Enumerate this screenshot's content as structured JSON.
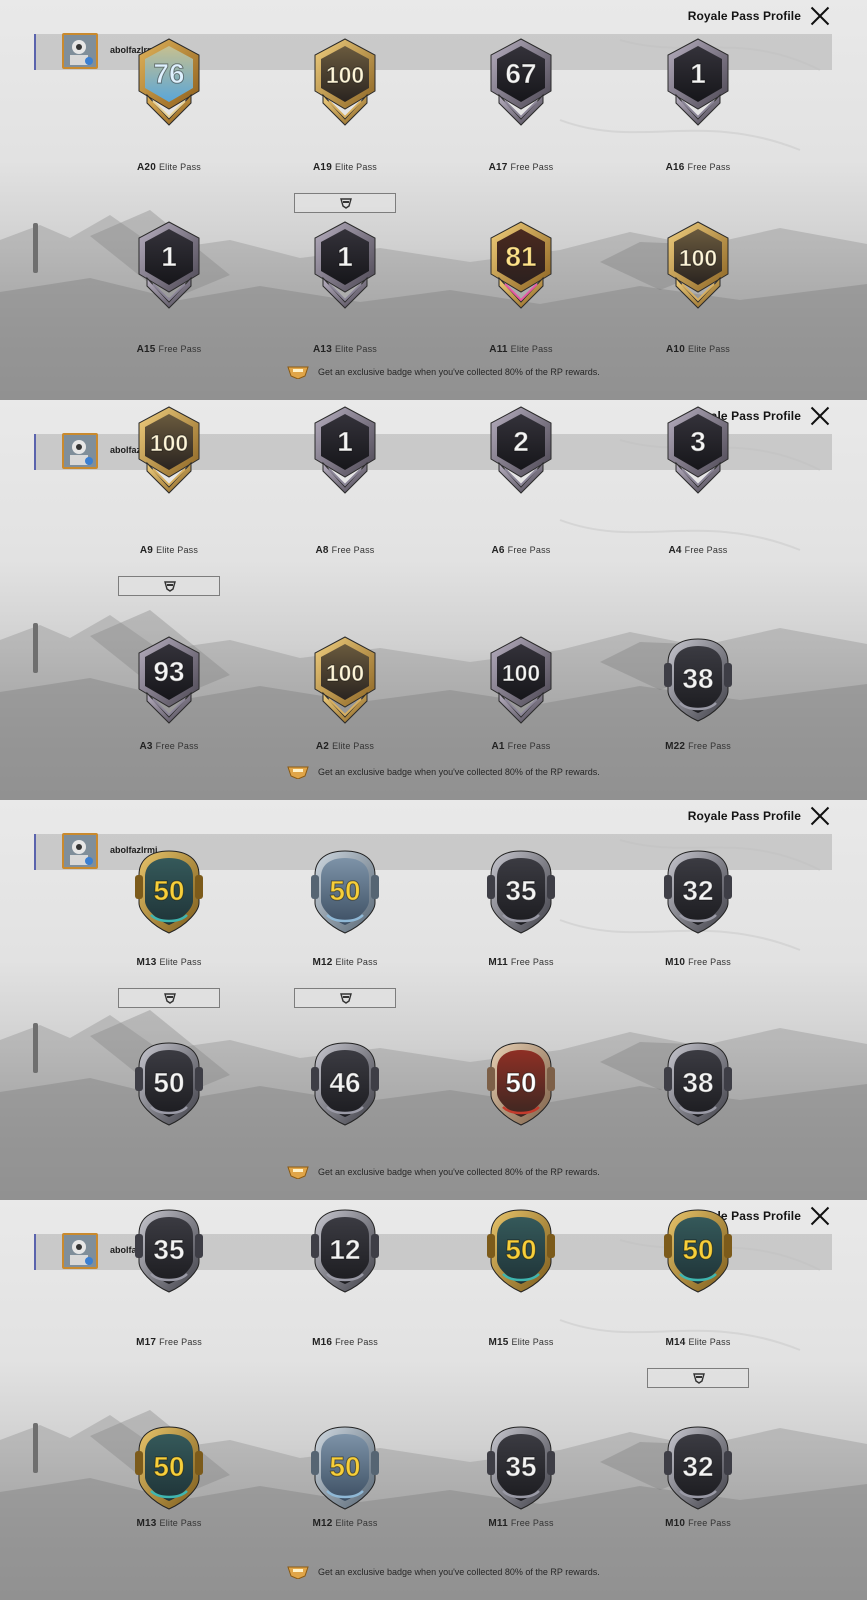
{
  "colors": {
    "accent_bar": "#5a63ad",
    "avatar_border": "#c98a2e",
    "free_pass_badge": "#1c1c20",
    "elite_gold": "#c99a44",
    "elite_teal": "#3fb6b0"
  },
  "screens": [
    {
      "header_title": "Royale Pass Profile",
      "username": "abolfazlrmj",
      "footer_text": "Get an exclusive badge when you've collected 80% of the RP rewards.",
      "badges": [
        {
          "num": "76",
          "season": "A20",
          "pass": "Elite Pass",
          "style": "ace-elite-blue",
          "equipped": false
        },
        {
          "num": "100",
          "season": "A19",
          "pass": "Elite Pass",
          "style": "ace-elite-gold",
          "equipped": true
        },
        {
          "num": "67",
          "season": "A17",
          "pass": "Free Pass",
          "style": "ace-free",
          "equipped": false
        },
        {
          "num": "1",
          "season": "A16",
          "pass": "Free Pass",
          "style": "ace-free",
          "equipped": false
        },
        {
          "num": "1",
          "season": "A15",
          "pass": "Free Pass",
          "style": "ace-free",
          "equipped": false
        },
        {
          "num": "1",
          "season": "A13",
          "pass": "Elite Pass",
          "style": "ace-free",
          "equipped": false
        },
        {
          "num": "81",
          "season": "A11",
          "pass": "Elite Pass",
          "style": "ace-elite-pink",
          "equipped": false
        },
        {
          "num": "100",
          "season": "A10",
          "pass": "Elite Pass",
          "style": "ace-elite-gold",
          "equipped": false
        }
      ]
    },
    {
      "header_title": "Royale Pass Profile",
      "username": "abolfazlrmj",
      "footer_text": "Get an exclusive badge when you've collected 80% of the RP rewards.",
      "badges": [
        {
          "num": "100",
          "season": "A9",
          "pass": "Elite Pass",
          "style": "ace-elite-gold",
          "equipped": true
        },
        {
          "num": "1",
          "season": "A8",
          "pass": "Free Pass",
          "style": "ace-free",
          "equipped": false
        },
        {
          "num": "2",
          "season": "A6",
          "pass": "Free Pass",
          "style": "ace-free",
          "equipped": false
        },
        {
          "num": "3",
          "season": "A4",
          "pass": "Free Pass",
          "style": "ace-free",
          "equipped": false
        },
        {
          "num": "93",
          "season": "A3",
          "pass": "Free Pass",
          "style": "ace-free",
          "equipped": false
        },
        {
          "num": "100",
          "season": "A2",
          "pass": "Elite Pass",
          "style": "ace-elite-gold",
          "equipped": false
        },
        {
          "num": "100",
          "season": "A1",
          "pass": "Free Pass",
          "style": "ace-free",
          "equipped": false
        },
        {
          "num": "38",
          "season": "M22",
          "pass": "Free Pass",
          "style": "m-free",
          "equipped": false
        }
      ]
    },
    {
      "header_title": "Royale Pass Profile",
      "username": "abolfazlrmj",
      "footer_text": "Get an exclusive badge when you've collected 80% of the RP rewards.",
      "badges": [
        {
          "num": "50",
          "season": "M13",
          "pass": "Elite Pass",
          "style": "m-elite-teal",
          "equipped": true
        },
        {
          "num": "50",
          "season": "M12",
          "pass": "Elite Pass",
          "style": "m-elite-silver",
          "equipped": true
        },
        {
          "num": "35",
          "season": "M11",
          "pass": "Free Pass",
          "style": "m-free",
          "equipped": false
        },
        {
          "num": "32",
          "season": "M10",
          "pass": "Free Pass",
          "style": "m-free",
          "equipped": false
        },
        {
          "num": "50",
          "season": "",
          "pass": "",
          "style": "m-free",
          "equipped": false
        },
        {
          "num": "46",
          "season": "",
          "pass": "",
          "style": "m-free",
          "equipped": false
        },
        {
          "num": "50",
          "season": "",
          "pass": "",
          "style": "m-elite-red",
          "equipped": false
        },
        {
          "num": "38",
          "season": "",
          "pass": "",
          "style": "m-free",
          "equipped": false
        }
      ]
    },
    {
      "header_title": "Royale Pass Profile",
      "username": "abolfazlrmj",
      "footer_text": "Get an exclusive badge when you've collected 80% of the RP rewards.",
      "badges": [
        {
          "num": "35",
          "season": "M17",
          "pass": "Free Pass",
          "style": "m-free",
          "equipped": false
        },
        {
          "num": "12",
          "season": "M16",
          "pass": "Free Pass",
          "style": "m-free",
          "equipped": false
        },
        {
          "num": "50",
          "season": "M15",
          "pass": "Elite Pass",
          "style": "m-elite-teal",
          "equipped": false
        },
        {
          "num": "50",
          "season": "M14",
          "pass": "Elite Pass",
          "style": "m-elite-teal",
          "equipped": true
        },
        {
          "num": "50",
          "season": "M13",
          "pass": "Elite Pass",
          "style": "m-elite-teal",
          "equipped": false
        },
        {
          "num": "50",
          "season": "M12",
          "pass": "Elite Pass",
          "style": "m-elite-silver",
          "equipped": false
        },
        {
          "num": "35",
          "season": "M11",
          "pass": "Free Pass",
          "style": "m-free",
          "equipped": false
        },
        {
          "num": "32",
          "season": "M10",
          "pass": "Free Pass",
          "style": "m-free",
          "equipped": false
        }
      ]
    }
  ]
}
